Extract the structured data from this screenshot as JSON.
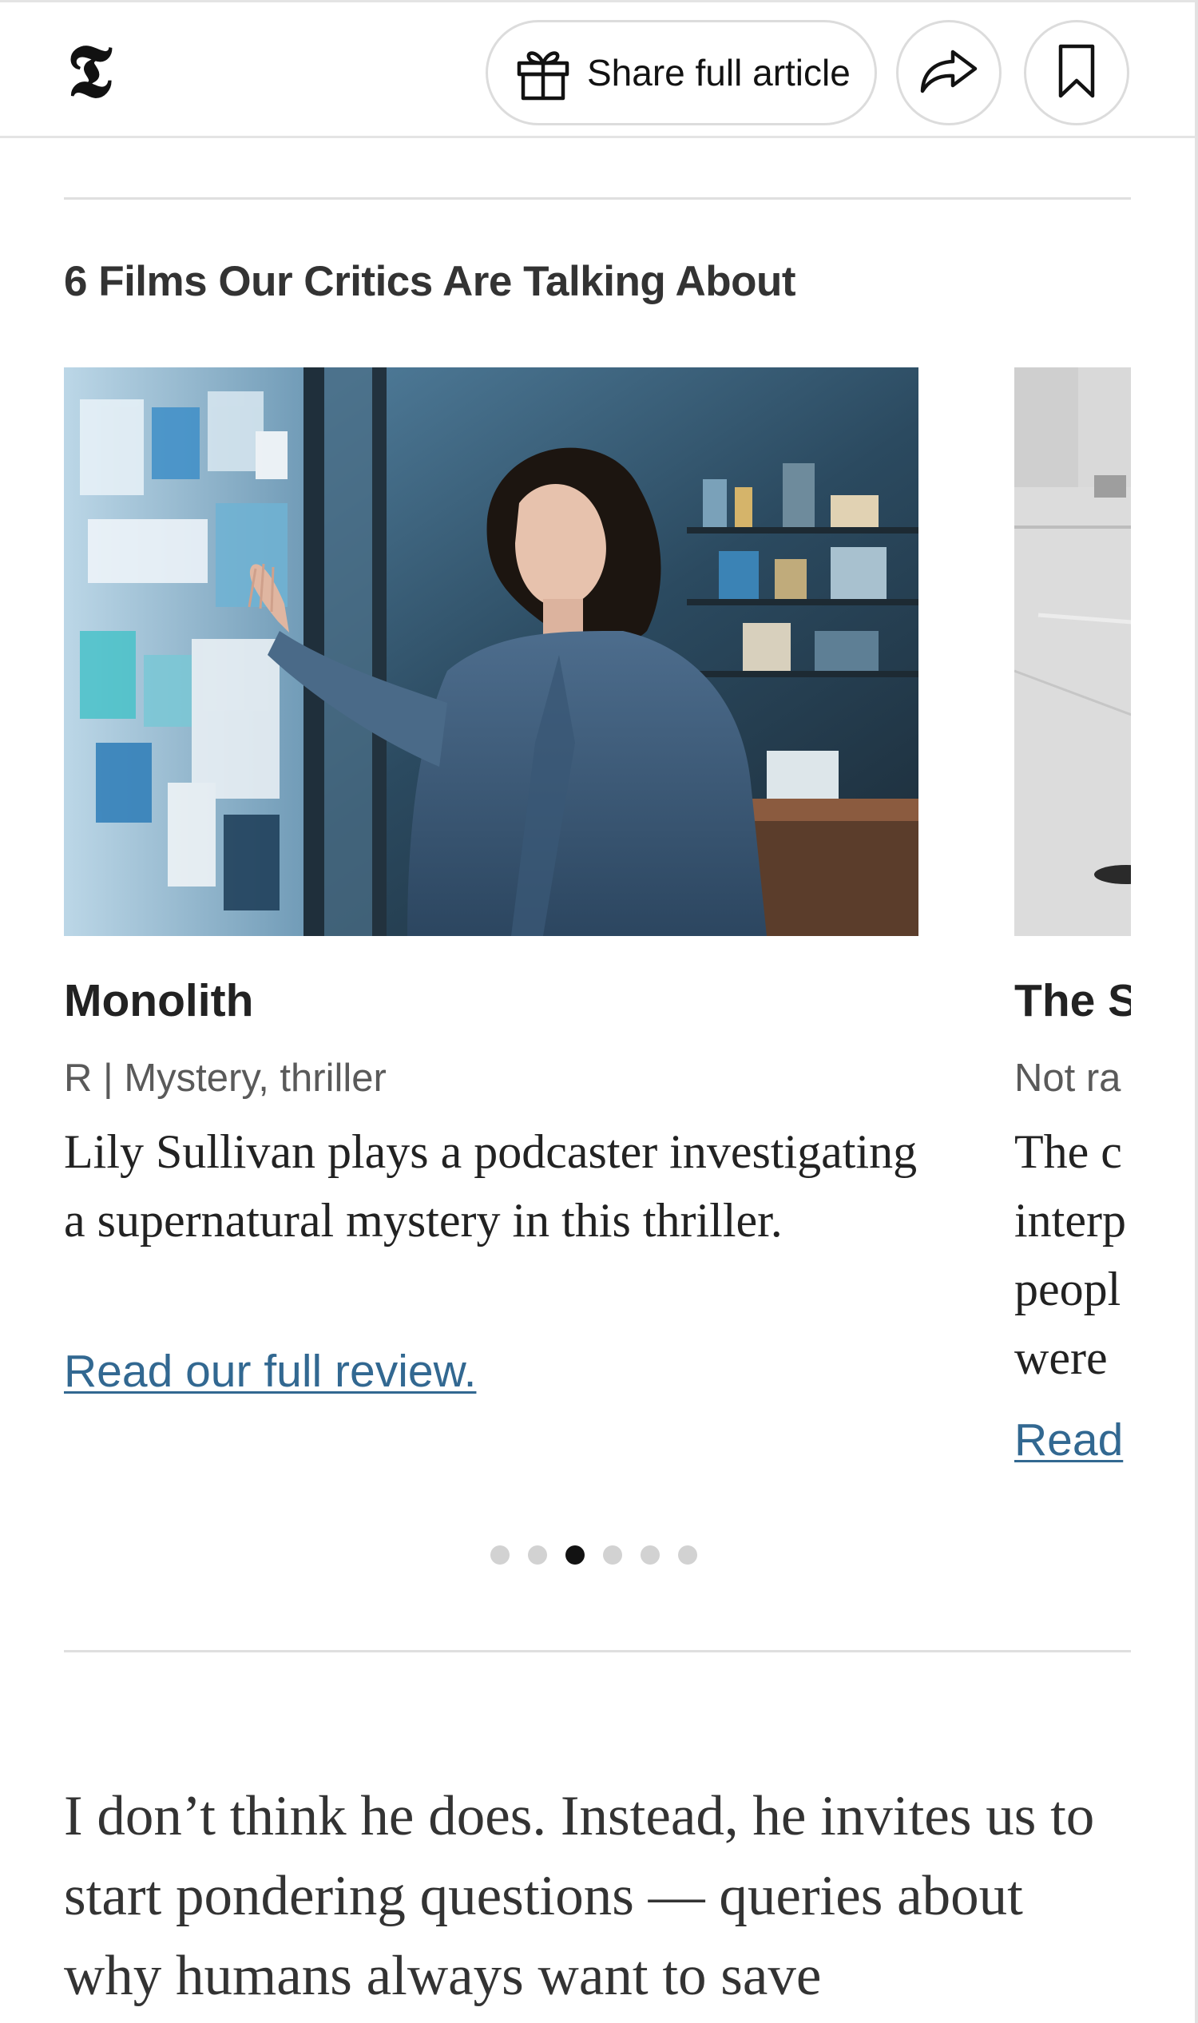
{
  "header": {
    "logo_alt": "The New York Times",
    "logo_glyph": "𝕿",
    "share_full_article_label": "Share full article",
    "icons": [
      "gift-icon",
      "share-arrow-icon",
      "bookmark-icon"
    ]
  },
  "carousel": {
    "heading": "6 Films Our Critics Are Talking About",
    "total_slides": 6,
    "active_slide_index": 2,
    "cards": [
      {
        "title": "Monolith",
        "meta": "R | Mystery, thriller",
        "description": "Lily Sullivan plays a podcaster investigating a supernatural mystery in this thriller.",
        "link_text": "Read our full review."
      },
      {
        "title_visible": "The S",
        "meta_visible": "Not ra",
        "description_lines_visible": [
          "The c",
          "interp",
          "peopl",
          "were"
        ],
        "link_text_visible": "Read"
      }
    ]
  },
  "article": {
    "paragraph_visible": "I don’t think he does. Instead, he invites us to start pondering questions — queries about why humans always want to save"
  },
  "colors": {
    "link": "#326891",
    "text": "#222222",
    "meta": "#5a5a5a",
    "rule": "#dfdfdf",
    "dot_active": "#121212",
    "dot_inactive": "#d2d2d2"
  }
}
